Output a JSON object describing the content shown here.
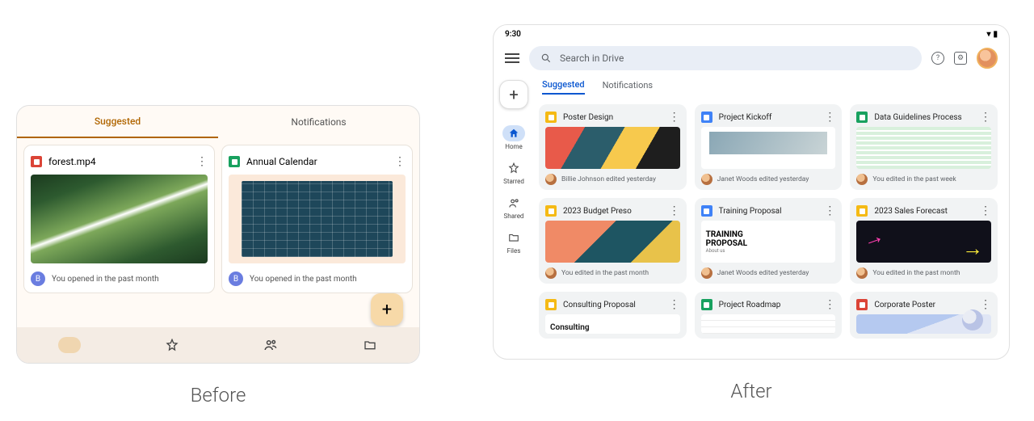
{
  "labels": {
    "before": "Before",
    "after": "After"
  },
  "before": {
    "tabs": {
      "suggested": "Suggested",
      "notifications": "Notifications"
    },
    "cards": [
      {
        "title": "forest.mp4",
        "caption": "You opened in the past month",
        "avatar": "B"
      },
      {
        "title": "Annual Calendar",
        "caption": "You opened in the past month",
        "avatar": "B"
      }
    ]
  },
  "after": {
    "status_time": "9:30",
    "search_placeholder": "Search in Drive",
    "tabs": {
      "suggested": "Suggested",
      "notifications": "Notifications"
    },
    "rail": {
      "home": "Home",
      "starred": "Starred",
      "shared": "Shared",
      "files": "Files"
    },
    "cards": [
      {
        "title": "Poster Design",
        "caption": "Billie Johnson edited yesterday",
        "ic": "slides"
      },
      {
        "title": "Project Kickoff",
        "caption": "Janet Woods edited yesterday",
        "ic": "docs"
      },
      {
        "title": "Data Guidelines Process",
        "caption": "You edited in the past week",
        "ic": "sheets"
      },
      {
        "title": "2023 Budget Preso",
        "caption": "You edited in the past month",
        "ic": "slides"
      },
      {
        "title": "Training Proposal",
        "caption": "Janet Woods edited yesterday",
        "ic": "docs"
      },
      {
        "title": "2023 Sales Forecast",
        "caption": "You edited in the past month",
        "ic": "slides"
      },
      {
        "title": "Consulting Proposal",
        "caption": "",
        "ic": "slides"
      },
      {
        "title": "Project Roadmap",
        "caption": "",
        "ic": "sheets"
      },
      {
        "title": "Corporate Poster",
        "caption": "",
        "ic": "draw"
      }
    ],
    "training_line1": "TRAINING",
    "training_line2": "PROPOSAL",
    "training_sub": "About us",
    "consulting_thumb": "Consulting"
  }
}
